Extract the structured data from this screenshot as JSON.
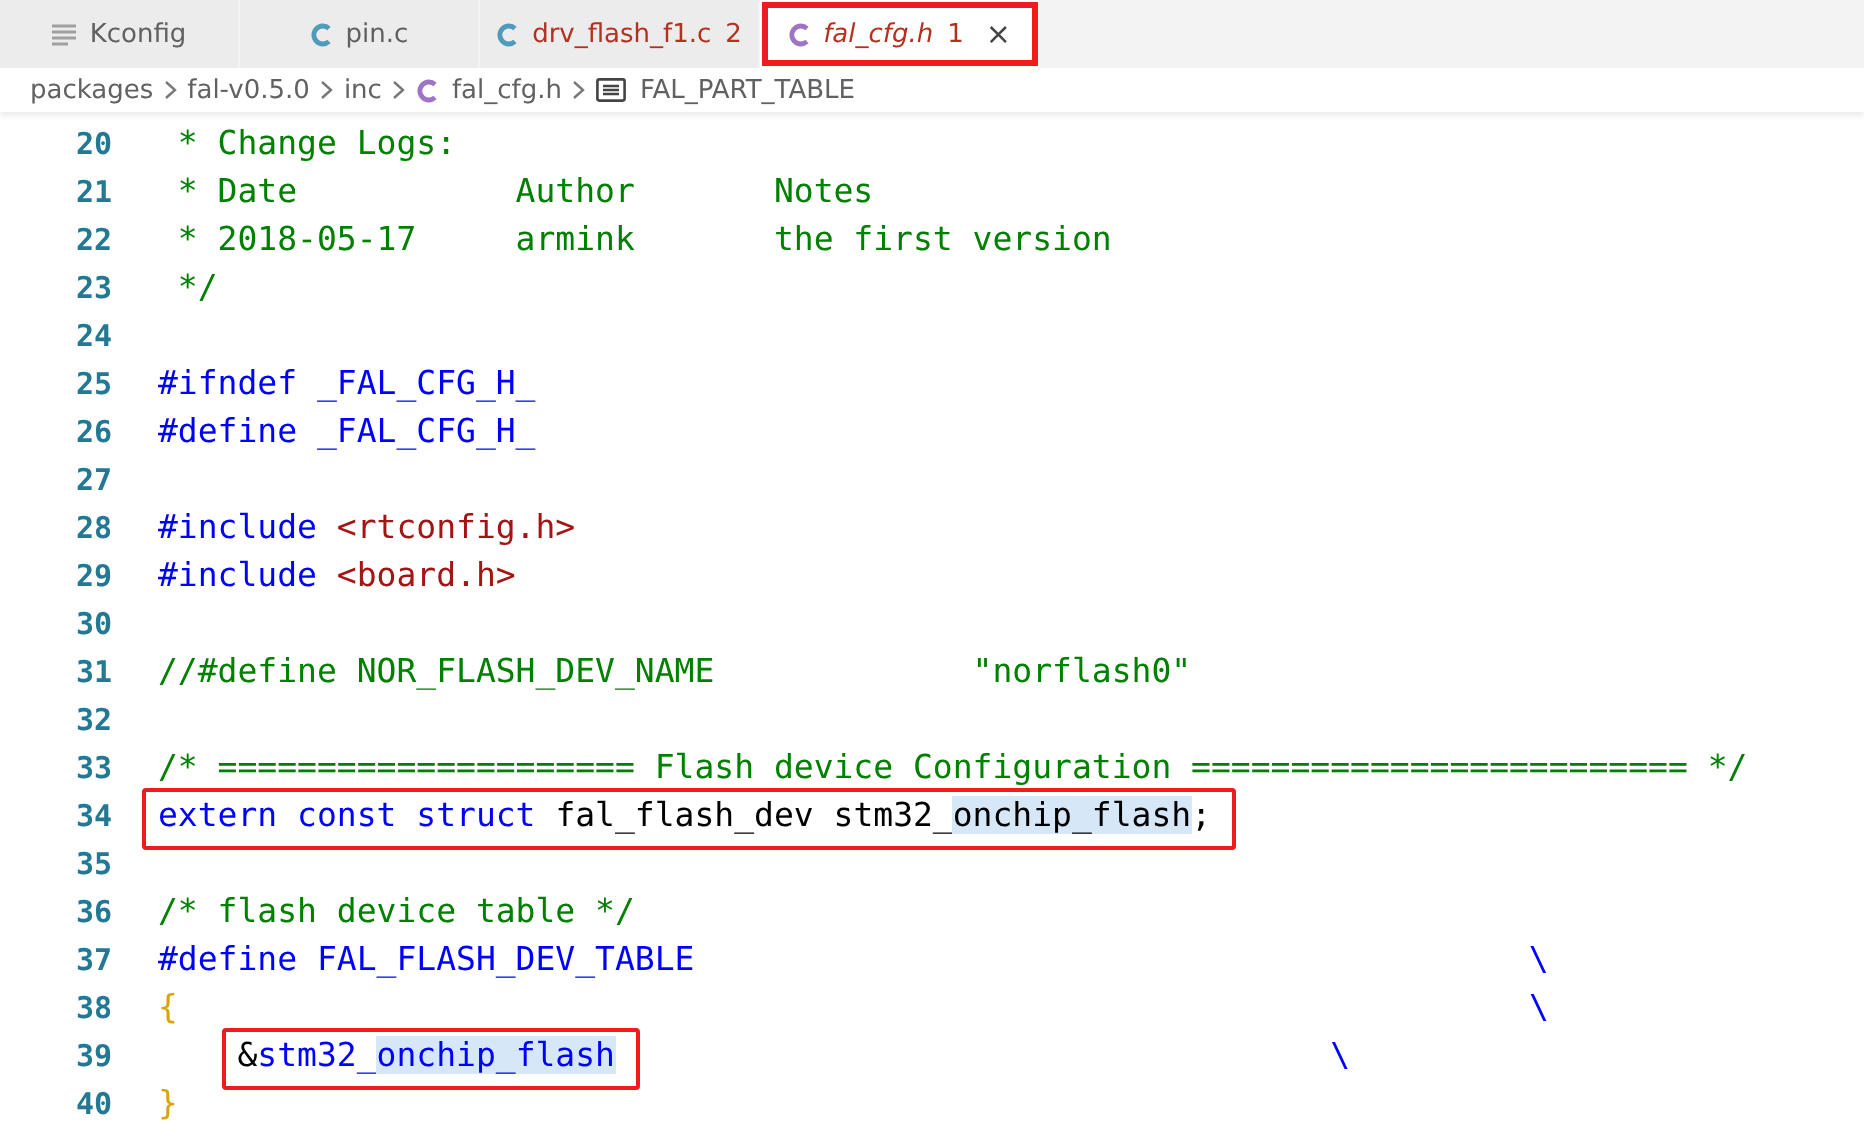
{
  "tabs": [
    {
      "label": "Kconfig",
      "kind": "text",
      "selected": false,
      "errors": false,
      "annotated": false
    },
    {
      "label": "pin.c",
      "kind": "source",
      "selected": false,
      "errors": false,
      "annotated": false
    },
    {
      "label": "drv_flash_f1.c",
      "kind": "source",
      "selected": false,
      "errors": true,
      "problems": "2",
      "annotated": false
    },
    {
      "label": "fal_cfg.h",
      "kind": "header",
      "selected": true,
      "errors": true,
      "problems": "1",
      "preview": true,
      "annotated": true,
      "close": "×"
    }
  ],
  "breadcrumbs": [
    {
      "label": "packages",
      "kind": "folder"
    },
    {
      "label": "fal-v0.5.0",
      "kind": "folder"
    },
    {
      "label": "inc",
      "kind": "folder"
    },
    {
      "label": "fal_cfg.h",
      "kind": "header"
    },
    {
      "label": "FAL_PART_TABLE",
      "kind": "symbol"
    }
  ],
  "editor": {
    "lines": [
      {
        "number": "20",
        "tokens": [
          {
            "text": " * Change Logs:",
            "kind": "comment"
          }
        ]
      },
      {
        "number": "21",
        "tokens": [
          {
            "text": " * Date           Author       Notes",
            "kind": "comment"
          }
        ]
      },
      {
        "number": "22",
        "tokens": [
          {
            "text": " * 2018-05-17     armink       the first version",
            "kind": "comment"
          }
        ]
      },
      {
        "number": "23",
        "tokens": [
          {
            "text": " */",
            "kind": "comment"
          }
        ]
      },
      {
        "number": "24"
      },
      {
        "number": "25",
        "tokens": [
          {
            "text": "#ifndef _FAL_CFG_H_",
            "kind": "keyword"
          }
        ]
      },
      {
        "number": "26",
        "tokens": [
          {
            "text": "#define _FAL_CFG_H_",
            "kind": "keyword"
          }
        ]
      },
      {
        "number": "27"
      },
      {
        "number": "28",
        "tokens": [
          {
            "text": "#include ",
            "kind": "keyword"
          },
          {
            "text": "<rtconfig.h>",
            "kind": "string"
          }
        ]
      },
      {
        "number": "29",
        "tokens": [
          {
            "text": "#include ",
            "kind": "keyword"
          },
          {
            "text": "<board.h>",
            "kind": "string"
          }
        ]
      },
      {
        "number": "30"
      },
      {
        "number": "31",
        "tokens": [
          {
            "text": "//#define NOR_FLASH_DEV_NAME             \"norflash0\"",
            "kind": "comment"
          }
        ]
      },
      {
        "number": "32"
      },
      {
        "number": "33",
        "tokens": [
          {
            "text": "/* ===================== Flash device Configuration ========================= */",
            "kind": "comment"
          }
        ]
      },
      {
        "number": "34",
        "tokens": [
          {
            "text": "extern const struct ",
            "kind": "keyword",
            "boxed": true
          },
          {
            "text": "fal_flash_dev stm32_",
            "kind": "plain",
            "boxed": true
          },
          {
            "text": "onchip_flash",
            "kind": "plain",
            "highlight": true,
            "boxed": true
          },
          {
            "text": ";",
            "kind": "plain",
            "boxed": true
          }
        ]
      },
      {
        "number": "35"
      },
      {
        "number": "36",
        "tokens": [
          {
            "text": "/* flash device table */",
            "kind": "comment"
          }
        ]
      },
      {
        "number": "37",
        "tokens": [
          {
            "text": "#define FAL_FLASH_DEV_TABLE                                          \\",
            "kind": "keyword"
          }
        ]
      },
      {
        "number": "38",
        "tokens": [
          {
            "text": "{",
            "kind": "bracket"
          },
          {
            "text": "                                                                    \\",
            "kind": "keyword"
          }
        ]
      },
      {
        "number": "39",
        "indented": true,
        "tokens": [
          {
            "text": "&",
            "kind": "plain",
            "boxed": true
          },
          {
            "text": "stm32_",
            "kind": "keyword",
            "boxed": true
          },
          {
            "text": "onchip_flash",
            "kind": "keyword",
            "highlight": true,
            "boxed": true
          },
          {
            "text": "                                    \\",
            "kind": "keyword"
          }
        ]
      },
      {
        "number": "40",
        "tokens": [
          {
            "text": "}",
            "kind": "bracket"
          }
        ]
      }
    ]
  }
}
